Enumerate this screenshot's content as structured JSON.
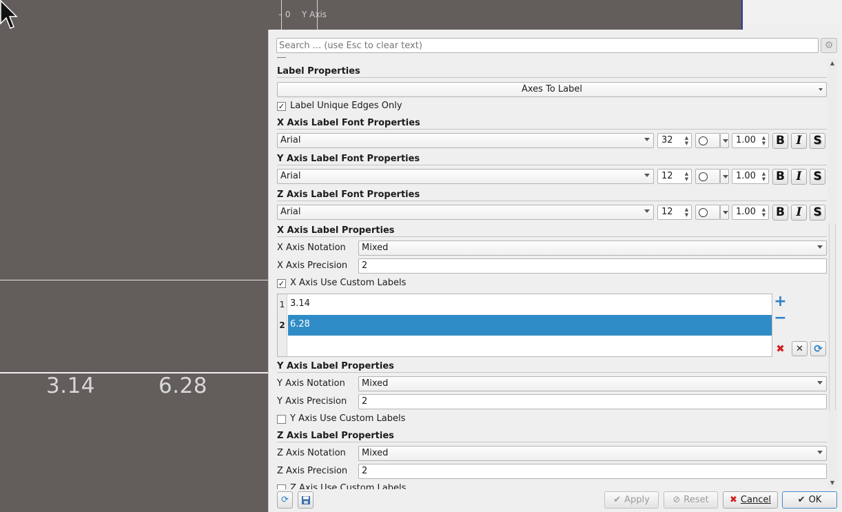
{
  "view": {
    "top_tick": "0",
    "top_axis_label": "Y Axis",
    "x_labels": [
      "3.14",
      "6.28"
    ]
  },
  "search": {
    "placeholder": "Search ... (use Esc to clear text)"
  },
  "sections": {
    "label_properties": {
      "title": "Label Properties",
      "axes_to_label": "Axes To Label",
      "unique_edges": {
        "label": "Label Unique Edges Only",
        "checked": true
      }
    },
    "x_font": {
      "title": "X Axis Label Font Properties",
      "family": "Arial",
      "size": "32",
      "opacity": "1.00"
    },
    "y_font": {
      "title": "Y Axis Label Font Properties",
      "family": "Arial",
      "size": "12",
      "opacity": "1.00"
    },
    "z_font": {
      "title": "Z Axis Label Font Properties",
      "family": "Arial",
      "size": "12",
      "opacity": "1.00"
    },
    "x_label": {
      "title": "X Axis Label Properties",
      "notation_label": "X Axis Notation",
      "notation": "Mixed",
      "precision_label": "X Axis Precision",
      "precision": "2",
      "custom_label": "X Axis Use Custom Labels",
      "custom_checked": true,
      "rows": [
        {
          "num": "1",
          "value": "3.14"
        },
        {
          "num": "2",
          "value": "6.28"
        }
      ]
    },
    "y_label": {
      "title": "Y Axis Label Properties",
      "notation_label": "Y Axis Notation",
      "notation": "Mixed",
      "precision_label": "Y Axis Precision",
      "precision": "2",
      "custom_label": "Y Axis Use Custom Labels",
      "custom_checked": false
    },
    "z_label": {
      "title": "Z Axis Label Properties",
      "notation_label": "Z Axis Notation",
      "notation": "Mixed",
      "precision_label": "Z Axis Precision",
      "precision": "2",
      "custom_label_partial": "Z Axis Use Custom Labels"
    }
  },
  "format_glyphs": {
    "bold": "B",
    "italic": "I",
    "shadow": "S"
  },
  "buttons": {
    "apply": "Apply",
    "reset": "Reset",
    "cancel": "Cancel",
    "ok": "OK"
  },
  "colors": {
    "selection": "#308cc6",
    "viewport_bg": "#635e5b",
    "add": "#2f7fc4",
    "delete": "#d21f1f"
  }
}
